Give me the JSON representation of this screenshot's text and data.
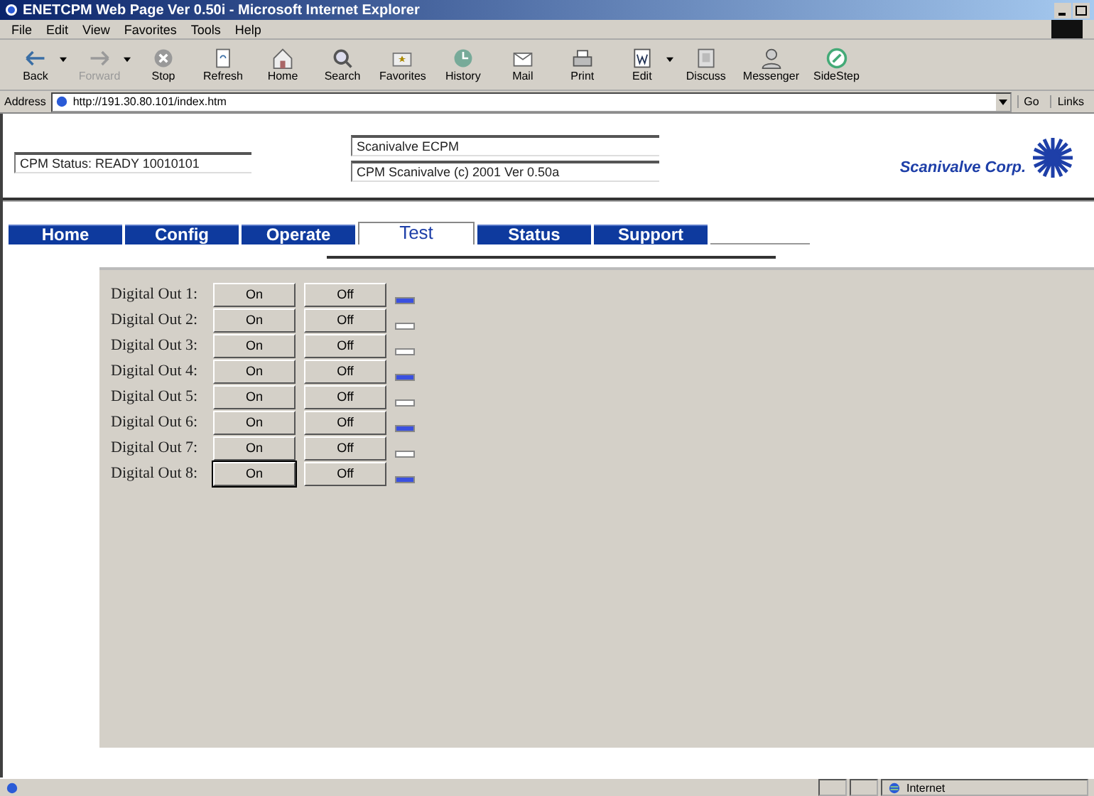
{
  "window": {
    "title": "ENETCPM Web Page Ver 0.50i - Microsoft Internet Explorer"
  },
  "menu": [
    "File",
    "Edit",
    "View",
    "Favorites",
    "Tools",
    "Help"
  ],
  "toolbar": [
    {
      "kind": "back",
      "label": "Back",
      "disabled": false,
      "dropdown": true
    },
    {
      "kind": "forward",
      "label": "Forward",
      "disabled": true,
      "dropdown": true
    },
    {
      "kind": "stop",
      "label": "Stop",
      "disabled": false,
      "dropdown": false
    },
    {
      "kind": "refresh",
      "label": "Refresh",
      "disabled": false,
      "dropdown": false
    },
    {
      "kind": "home",
      "label": "Home",
      "disabled": false,
      "dropdown": false
    },
    {
      "kind": "search",
      "label": "Search",
      "disabled": false,
      "dropdown": false
    },
    {
      "kind": "favorites",
      "label": "Favorites",
      "disabled": false,
      "dropdown": false
    },
    {
      "kind": "history",
      "label": "History",
      "disabled": false,
      "dropdown": false
    },
    {
      "kind": "mail",
      "label": "Mail",
      "disabled": false,
      "dropdown": false
    },
    {
      "kind": "print",
      "label": "Print",
      "disabled": false,
      "dropdown": false
    },
    {
      "kind": "edit",
      "label": "Edit",
      "disabled": false,
      "dropdown": true
    },
    {
      "kind": "discuss",
      "label": "Discuss",
      "disabled": false,
      "dropdown": false
    },
    {
      "kind": "messenger",
      "label": "Messenger",
      "disabled": false,
      "dropdown": false
    },
    {
      "kind": "sidestep",
      "label": "SideStep",
      "disabled": false,
      "dropdown": false
    }
  ],
  "address": {
    "label": "Address",
    "value": "http://191.30.80.101/index.htm",
    "go": "Go",
    "links": "Links"
  },
  "header": {
    "cpm_status": "CPM Status: READY 10010101",
    "title_field": "Scanivalve ECPM",
    "version_field": "CPM Scanivalve (c) 2001 Ver 0.50a",
    "logo_text": "Scanivalve Corp."
  },
  "tabs": [
    {
      "label": "Home",
      "selected": false
    },
    {
      "label": "Config",
      "selected": false
    },
    {
      "label": "Operate",
      "selected": false
    },
    {
      "label": "Test",
      "selected": true
    },
    {
      "label": "Status",
      "selected": false
    },
    {
      "label": "Support",
      "selected": false
    }
  ],
  "outputs": [
    {
      "label": "Digital Out 1:",
      "on_button": "On",
      "off_button": "Off",
      "on": true,
      "focused": false
    },
    {
      "label": "Digital Out 2:",
      "on_button": "On",
      "off_button": "Off",
      "on": false,
      "focused": false
    },
    {
      "label": "Digital Out 3:",
      "on_button": "On",
      "off_button": "Off",
      "on": false,
      "focused": false
    },
    {
      "label": "Digital Out 4:",
      "on_button": "On",
      "off_button": "Off",
      "on": true,
      "focused": false
    },
    {
      "label": "Digital Out 5:",
      "on_button": "On",
      "off_button": "Off",
      "on": false,
      "focused": false
    },
    {
      "label": "Digital Out 6:",
      "on_button": "On",
      "off_button": "Off",
      "on": true,
      "focused": false
    },
    {
      "label": "Digital Out 7:",
      "on_button": "On",
      "off_button": "Off",
      "on": false,
      "focused": false
    },
    {
      "label": "Digital Out 8:",
      "on_button": "On",
      "off_button": "Off",
      "on": true,
      "focused": true
    }
  ],
  "status_bar": {
    "zone": "Internet"
  }
}
